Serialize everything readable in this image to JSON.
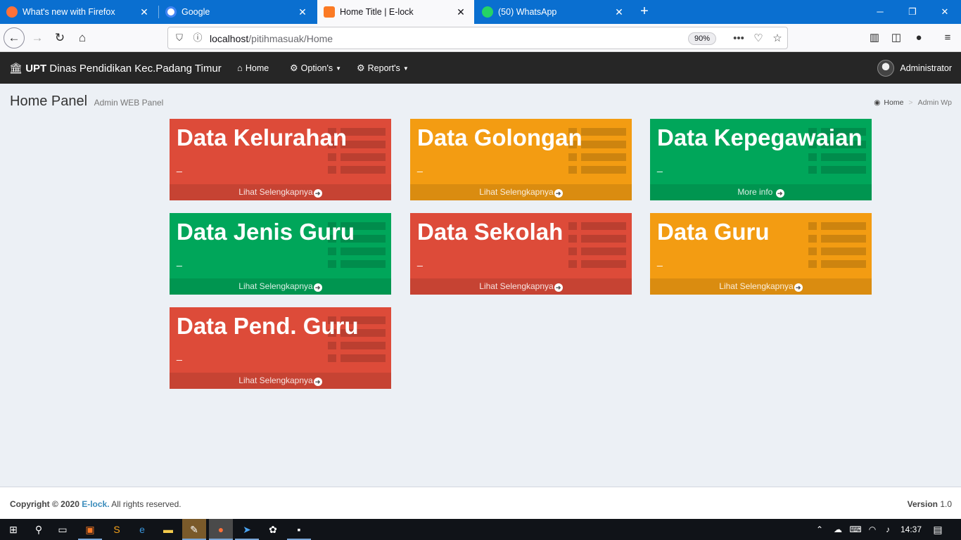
{
  "browser": {
    "tabs": [
      {
        "title": "What's new with Firefox",
        "icon": "firefox-icon",
        "color": "#ff7139"
      },
      {
        "title": "Google",
        "icon": "google-icon",
        "color": "#4285f4"
      },
      {
        "title": "Home Title | E-lock",
        "icon": "xampp-icon",
        "color": "#fb7a24"
      },
      {
        "title": "(50) WhatsApp",
        "icon": "whatsapp-icon",
        "color": "#25d366"
      }
    ],
    "active_tab_index": 2,
    "url_host": "localhost",
    "url_path": "/pitihmasuak/Home",
    "zoom": "90%"
  },
  "app": {
    "brand_bold": "UPT",
    "brand_rest": " Dinas Pendidikan Kec.Padang Timur",
    "menu": [
      {
        "label": "Home",
        "icon": "home-icon",
        "has_caret": false
      },
      {
        "label": "Option's",
        "icon": "gear-icon",
        "has_caret": true
      },
      {
        "label": "Report's",
        "icon": "gear-icon",
        "has_caret": true
      }
    ],
    "user_name": "Administrator"
  },
  "content_header": {
    "title": "Home Panel",
    "subtitle": "Admin WEB Panel",
    "breadcrumb": [
      "Home",
      "Admin Wp"
    ]
  },
  "boxes": [
    {
      "title": "Data Kelurahan",
      "value": "_",
      "link": "Lihat Selengkapnya",
      "color": "red"
    },
    {
      "title": "Data Golongan",
      "value": "_",
      "link": "Lihat Selengkapnya",
      "color": "yellow"
    },
    {
      "title": "Data Kepegawaian",
      "value": "_",
      "link": "More info",
      "color": "green"
    },
    {
      "title": "Data Jenis Guru",
      "value": "_",
      "link": "Lihat Selengkapnya",
      "color": "green"
    },
    {
      "title": "Data Sekolah",
      "value": "_",
      "link": "Lihat Selengkapnya",
      "color": "red"
    },
    {
      "title": "Data Guru",
      "value": "_",
      "link": "Lihat Selengkapnya",
      "color": "yellow"
    },
    {
      "title": "Data Pend. Guru",
      "value": "_",
      "link": "Lihat Selengkapnya",
      "color": "red"
    }
  ],
  "footer": {
    "copyright_prefix": "Copyright © 2020 ",
    "company": "E-lock.",
    "rights": " All rights reserved.",
    "version_label": "Version",
    "version": " 1.0"
  },
  "taskbar": {
    "time": "14:37"
  },
  "colors": {
    "red": "#dd4b39",
    "yellow": "#f39c12",
    "green": "#00a65a",
    "header": "#262626",
    "tabstrip": "#0a6fd0"
  }
}
